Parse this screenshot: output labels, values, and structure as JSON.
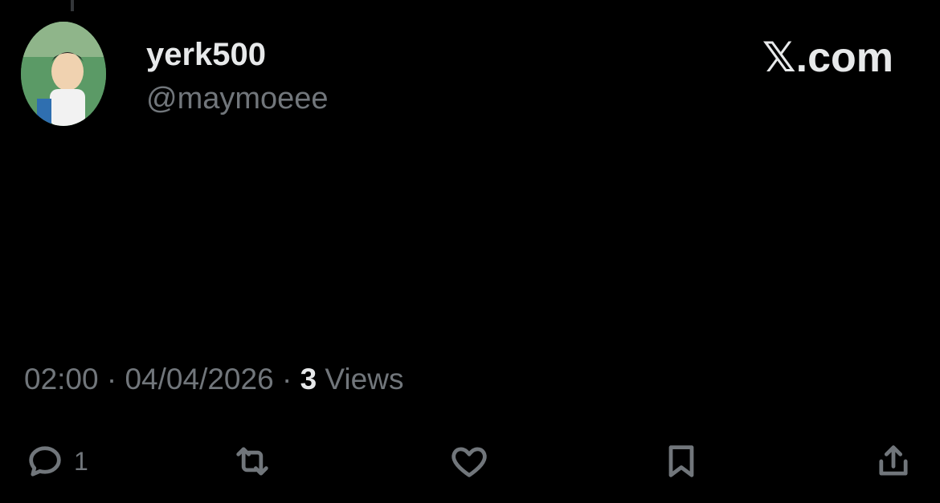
{
  "author": {
    "display_name": "yerk500",
    "handle": "@maymoeee",
    "avatar": "cartoon-avatar"
  },
  "brand": "𝕏.com",
  "post": {
    "text": "",
    "time": "02:00",
    "date": "04/04/2026",
    "views_count": "3",
    "views_label": "Views"
  },
  "actions": {
    "reply": {
      "icon": "reply-icon",
      "count": "1"
    },
    "repost": {
      "icon": "repost-icon",
      "count": ""
    },
    "like": {
      "icon": "heart-icon",
      "count": ""
    },
    "bookmark": {
      "icon": "bookmark-icon",
      "count": ""
    },
    "share": {
      "icon": "share-icon",
      "count": ""
    }
  },
  "colors": {
    "background": "#000000",
    "text": "#e7e9ea",
    "muted": "#71767b"
  }
}
